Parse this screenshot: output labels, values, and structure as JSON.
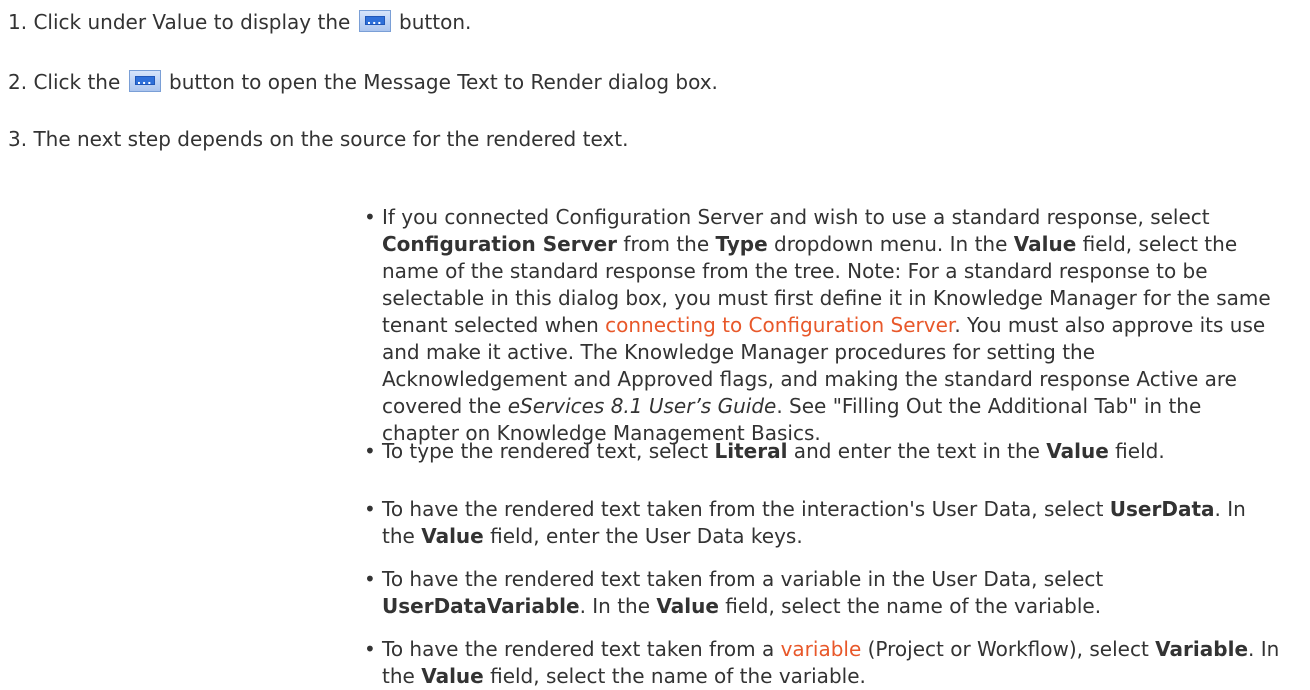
{
  "steps": [
    {
      "number": "1.",
      "before": "Click under Value to display the",
      "after": "button."
    },
    {
      "number": "2.",
      "before": "Click the",
      "after": "button to open the Message Text to Render dialog box."
    },
    {
      "number": "3.",
      "text": "The next step depends on the source for the rendered text."
    }
  ],
  "icons": {
    "ellipsis_button": "ellipsis-button-icon",
    "ellipsis_glyph": "..."
  },
  "colors": {
    "link": "#e8582a",
    "text": "#333333"
  },
  "bullets": {
    "b1": {
      "t1": "If you connected Configuration Server and wish to use a standard response, select ",
      "b1": "Configuration Server",
      "t2": " from the ",
      "b2": "Type",
      "t3": " dropdown menu. In the ",
      "b3": "Value",
      "t4": " field, select the name of the standard response from the tree.  Note:  For a standard response to be selectable in this dialog box, you must first define it in Knowledge Manager for the same tenant selected when ",
      "link": "connecting to Configuration Server",
      "t5": ". You must also approve its use and make it active. The Knowledge Manager procedures for setting the Acknowledgement and Approved flags, and making the standard response Active are covered the ",
      "i1": "eServices 8.1 User’s Guide",
      "t6": ". See \"Filling Out the Additional Tab\" in the chapter on Knowledge Management Basics."
    },
    "b2": {
      "t1": "To type the rendered text, select ",
      "b1": "Literal",
      "t2": " and enter the text in the ",
      "b2": "Value",
      "t3": " field."
    },
    "b3": {
      "t1": "To have the rendered text taken from the interaction's User Data, select ",
      "b1": "UserData",
      "t2": ". In the ",
      "b2": "Value",
      "t3": " field, enter the User Data keys."
    },
    "b4": {
      "t1": "To have the rendered text taken from a variable in the User Data, select ",
      "b1": "UserDataVariable",
      "t2": ".  In the ",
      "b2": "Value",
      "t3": " field, select the name of the variable."
    },
    "b5": {
      "t1": "To have the rendered text taken from a ",
      "link": "variable",
      "t2": " (Project or Workflow), select ",
      "b1": "Variable",
      "t3": ".  In the ",
      "b2": "Value",
      "t4": " field, select the name of the variable."
    }
  }
}
